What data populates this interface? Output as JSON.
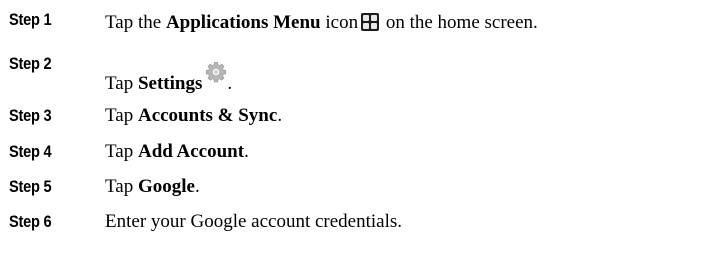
{
  "steps": [
    {
      "label": "Step 1",
      "pre": "Tap the ",
      "bold": "Applications Menu",
      "post": " icon",
      "icon": "applications-menu-icon",
      "after": " on the home screen."
    },
    {
      "label": "Step 2",
      "pre": "Tap ",
      "bold": "Settings",
      "post": "",
      "icon": "settings-gear-icon",
      "after": "."
    },
    {
      "label": "Step 3",
      "pre": "Tap ",
      "bold": "Accounts & Sync",
      "post": "."
    },
    {
      "label": "Step 4",
      "pre": "Tap ",
      "bold": "Add Account",
      "post": "."
    },
    {
      "label": "Step 5",
      "pre": "Tap ",
      "bold": "Google",
      "post": "."
    },
    {
      "label": "Step 6",
      "text": "Enter your Google account credentials."
    }
  ],
  "colors": {
    "text": "#000000",
    "background": "#ffffff",
    "icon_dark": "#1c1c1c",
    "icon_light": "#e8e8e8"
  }
}
